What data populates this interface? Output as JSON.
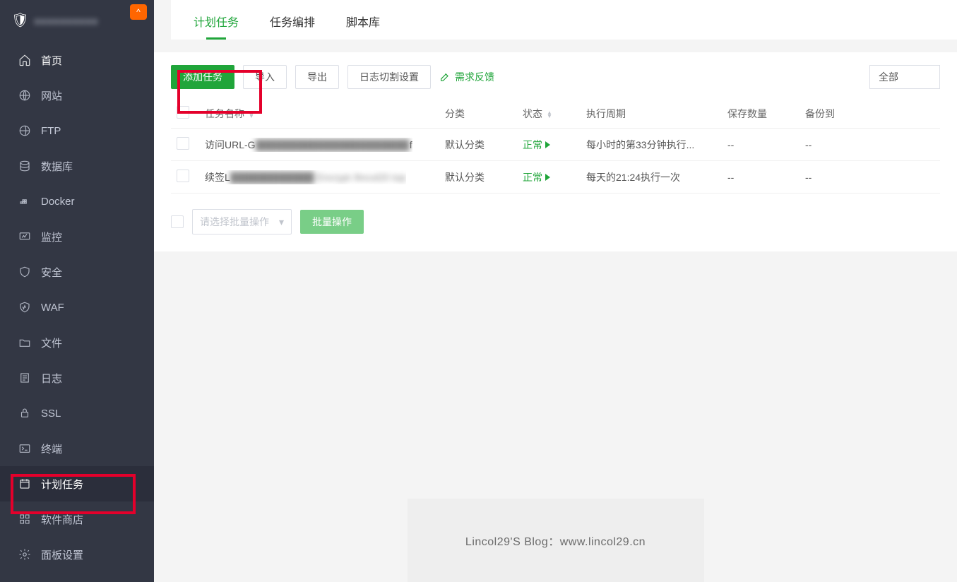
{
  "brand": {
    "label": "●●●●●●●●●●",
    "badge_text": "^"
  },
  "sidebar": {
    "items": [
      {
        "label": "首页",
        "icon": "home"
      },
      {
        "label": "网站",
        "icon": "globe"
      },
      {
        "label": "FTP",
        "icon": "globe"
      },
      {
        "label": "数据库",
        "icon": "db"
      },
      {
        "label": "Docker",
        "icon": "docker"
      },
      {
        "label": "监控",
        "icon": "monitor"
      },
      {
        "label": "安全",
        "icon": "shield"
      },
      {
        "label": "WAF",
        "icon": "waf"
      },
      {
        "label": "文件",
        "icon": "folder"
      },
      {
        "label": "日志",
        "icon": "log"
      },
      {
        "label": "SSL",
        "icon": "ssl"
      },
      {
        "label": "终端",
        "icon": "terminal"
      },
      {
        "label": "计划任务",
        "icon": "calendar"
      },
      {
        "label": "软件商店",
        "icon": "apps"
      },
      {
        "label": "面板设置",
        "icon": "gear"
      }
    ]
  },
  "tabs": [
    {
      "label": "计划任务"
    },
    {
      "label": "任务编排"
    },
    {
      "label": "脚本库"
    }
  ],
  "toolbar": {
    "add": "添加任务",
    "import": "导入",
    "export": "导出",
    "log_cfg": "日志切割设置",
    "feedback": "需求反馈",
    "filter_value": "全部"
  },
  "table": {
    "headers": {
      "name": "任务名称",
      "category": "分类",
      "status": "状态",
      "cycle": "执行周期",
      "keep": "保存数量",
      "backup_to": "备份到"
    },
    "rows": [
      {
        "name_prefix": "访问URL-G",
        "name_blur": "██████████████████████",
        "name_suffix": "f",
        "category": "默认分类",
        "status": "正常",
        "cycle": "每小时的第33分钟执行...",
        "keep": "--",
        "backup_to": "--"
      },
      {
        "name_prefix": "续签L",
        "name_blur": "████████████ Encrypt /lincol20 top",
        "name_suffix": "",
        "category": "默认分类",
        "status": "正常",
        "cycle": "每天的21:24执行一次",
        "keep": "--",
        "backup_to": "--"
      }
    ]
  },
  "batch": {
    "placeholder": "请选择批量操作",
    "action": "批量操作"
  },
  "footer": "Lincol29'S Blog：www.lincol29.cn"
}
